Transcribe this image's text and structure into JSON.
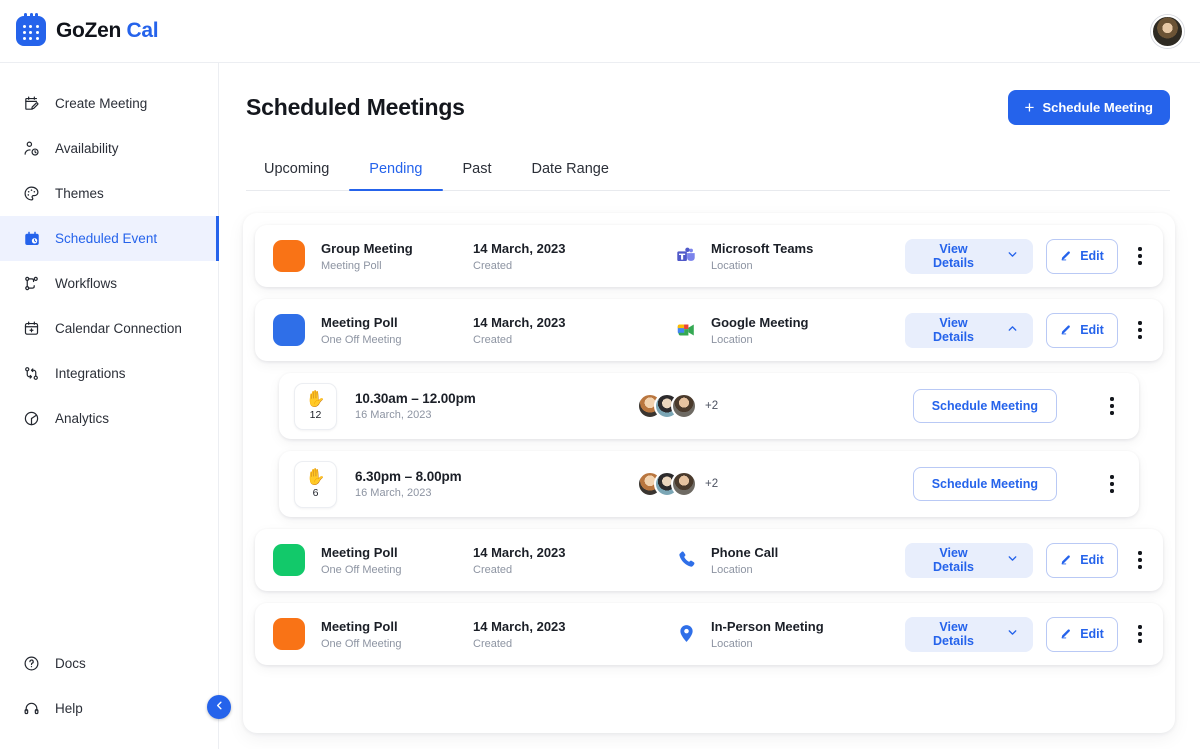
{
  "brand": {
    "name_dark": "GoZen",
    "name_accent": "Cal",
    "logo_icon": "calendar-dots-icon"
  },
  "topbar": {
    "avatar_icon": "user-avatar"
  },
  "sidebar": {
    "items": [
      {
        "label": "Create Meeting",
        "icon": "calendar-edit-icon",
        "active": false
      },
      {
        "label": "Availability",
        "icon": "person-clock-icon",
        "active": false
      },
      {
        "label": "Themes",
        "icon": "palette-icon",
        "active": false
      },
      {
        "label": "Scheduled Event",
        "icon": "calendar-clock-icon",
        "active": true
      },
      {
        "label": "Workflows",
        "icon": "workflow-icon",
        "active": false
      },
      {
        "label": "Calendar Connection",
        "icon": "calendar-plus-icon",
        "active": false
      },
      {
        "label": "Integrations",
        "icon": "integrations-icon",
        "active": false
      },
      {
        "label": "Analytics",
        "icon": "pie-chart-icon",
        "active": false
      }
    ],
    "bottom_items": [
      {
        "label": "Docs",
        "icon": "question-circle-icon"
      },
      {
        "label": "Help",
        "icon": "headset-icon"
      }
    ],
    "collapse_icon": "chevron-left-icon"
  },
  "main": {
    "page_title": "Scheduled Meetings",
    "schedule_button": {
      "label": "Schedule Meeting",
      "icon": "plus-icon"
    },
    "tabs": [
      {
        "label": "Upcoming",
        "active": false
      },
      {
        "label": "Pending",
        "active": true
      },
      {
        "label": "Past",
        "active": false
      },
      {
        "label": "Date Range",
        "active": false
      }
    ],
    "rows": [
      {
        "type": "meeting",
        "swatch_color": "#f97316",
        "title": "Group Meeting",
        "subtitle": "Meeting Poll",
        "date": "14 March, 2023",
        "date_label": "Created",
        "location": "Microsoft Teams",
        "location_label": "Location",
        "location_icon": "microsoft-teams-icon",
        "view_details_label": "View Details",
        "view_details_chevron": "chevron-down-icon",
        "edit_label": "Edit",
        "edit_icon": "pencil-icon",
        "menu_icon": "kebab-menu-icon"
      },
      {
        "type": "meeting",
        "swatch_color": "#2f6fe8",
        "title": "Meeting Poll",
        "subtitle": "One Off Meeting",
        "date": "14 March, 2023",
        "date_label": "Created",
        "location": "Google Meeting",
        "location_label": "Location",
        "location_icon": "google-meet-icon",
        "view_details_label": "View Details",
        "view_details_chevron": "chevron-up-icon",
        "edit_label": "Edit",
        "edit_icon": "pencil-icon",
        "menu_icon": "kebab-menu-icon"
      },
      {
        "type": "slot",
        "vote_icon": "raised-hand-icon",
        "vote_count": "12",
        "time_range": "10.30am – 12.00pm",
        "date": "16 March, 2023",
        "attendees_more": "+2",
        "schedule_label": "Schedule Meeting",
        "menu_icon": "kebab-menu-icon"
      },
      {
        "type": "slot",
        "vote_icon": "raised-hand-icon",
        "vote_count": "6",
        "time_range": "6.30pm – 8.00pm",
        "date": "16 March, 2023",
        "attendees_more": "+2",
        "schedule_label": "Schedule Meeting",
        "menu_icon": "kebab-menu-icon"
      },
      {
        "type": "meeting",
        "swatch_color": "#12c96a",
        "title": "Meeting Poll",
        "subtitle": "One Off Meeting",
        "date": "14 March, 2023",
        "date_label": "Created",
        "location": "Phone Call",
        "location_label": "Location",
        "location_icon": "phone-icon",
        "view_details_label": "View Details",
        "view_details_chevron": "chevron-down-icon",
        "edit_label": "Edit",
        "edit_icon": "pencil-icon",
        "menu_icon": "kebab-menu-icon"
      },
      {
        "type": "meeting",
        "swatch_color": "#f97316",
        "title": "Meeting Poll",
        "subtitle": "One Off Meeting",
        "date": "14 March, 2023",
        "date_label": "Created",
        "location": "In-Person Meeting",
        "location_label": "Location",
        "location_icon": "map-pin-icon",
        "view_details_label": "View Details",
        "view_details_chevron": "chevron-down-icon",
        "edit_label": "Edit",
        "edit_icon": "pencil-icon",
        "menu_icon": "kebab-menu-icon"
      }
    ]
  },
  "colors": {
    "accent": "#2563eb",
    "accent_soft": "#e8eefc",
    "active_nav_bg": "#eef2fe",
    "text": "#1b1f27",
    "muted": "#8d94a2"
  }
}
